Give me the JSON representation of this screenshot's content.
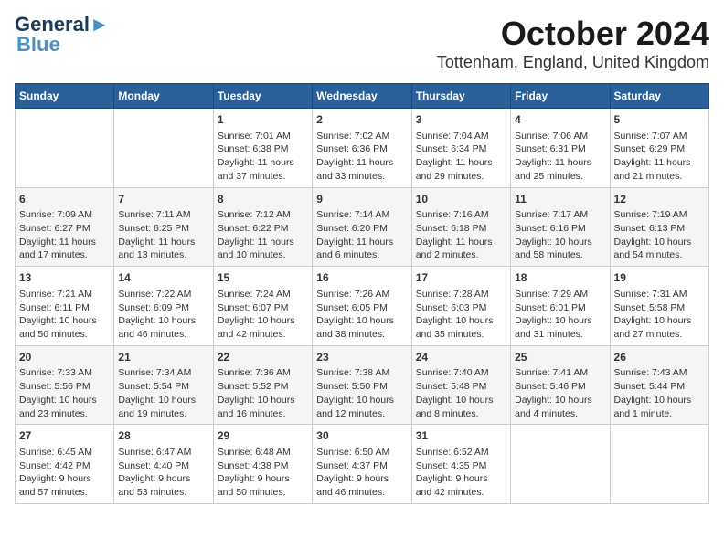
{
  "logo": {
    "text1": "General",
    "text2": "Blue"
  },
  "title": "October 2024",
  "subtitle": "Tottenham, England, United Kingdom",
  "headers": [
    "Sunday",
    "Monday",
    "Tuesday",
    "Wednesday",
    "Thursday",
    "Friday",
    "Saturday"
  ],
  "weeks": [
    [
      {
        "num": "",
        "content": ""
      },
      {
        "num": "",
        "content": ""
      },
      {
        "num": "1",
        "content": "Sunrise: 7:01 AM\nSunset: 6:38 PM\nDaylight: 11 hours\nand 37 minutes."
      },
      {
        "num": "2",
        "content": "Sunrise: 7:02 AM\nSunset: 6:36 PM\nDaylight: 11 hours\nand 33 minutes."
      },
      {
        "num": "3",
        "content": "Sunrise: 7:04 AM\nSunset: 6:34 PM\nDaylight: 11 hours\nand 29 minutes."
      },
      {
        "num": "4",
        "content": "Sunrise: 7:06 AM\nSunset: 6:31 PM\nDaylight: 11 hours\nand 25 minutes."
      },
      {
        "num": "5",
        "content": "Sunrise: 7:07 AM\nSunset: 6:29 PM\nDaylight: 11 hours\nand 21 minutes."
      }
    ],
    [
      {
        "num": "6",
        "content": "Sunrise: 7:09 AM\nSunset: 6:27 PM\nDaylight: 11 hours\nand 17 minutes."
      },
      {
        "num": "7",
        "content": "Sunrise: 7:11 AM\nSunset: 6:25 PM\nDaylight: 11 hours\nand 13 minutes."
      },
      {
        "num": "8",
        "content": "Sunrise: 7:12 AM\nSunset: 6:22 PM\nDaylight: 11 hours\nand 10 minutes."
      },
      {
        "num": "9",
        "content": "Sunrise: 7:14 AM\nSunset: 6:20 PM\nDaylight: 11 hours\nand 6 minutes."
      },
      {
        "num": "10",
        "content": "Sunrise: 7:16 AM\nSunset: 6:18 PM\nDaylight: 11 hours\nand 2 minutes."
      },
      {
        "num": "11",
        "content": "Sunrise: 7:17 AM\nSunset: 6:16 PM\nDaylight: 10 hours\nand 58 minutes."
      },
      {
        "num": "12",
        "content": "Sunrise: 7:19 AM\nSunset: 6:13 PM\nDaylight: 10 hours\nand 54 minutes."
      }
    ],
    [
      {
        "num": "13",
        "content": "Sunrise: 7:21 AM\nSunset: 6:11 PM\nDaylight: 10 hours\nand 50 minutes."
      },
      {
        "num": "14",
        "content": "Sunrise: 7:22 AM\nSunset: 6:09 PM\nDaylight: 10 hours\nand 46 minutes."
      },
      {
        "num": "15",
        "content": "Sunrise: 7:24 AM\nSunset: 6:07 PM\nDaylight: 10 hours\nand 42 minutes."
      },
      {
        "num": "16",
        "content": "Sunrise: 7:26 AM\nSunset: 6:05 PM\nDaylight: 10 hours\nand 38 minutes."
      },
      {
        "num": "17",
        "content": "Sunrise: 7:28 AM\nSunset: 6:03 PM\nDaylight: 10 hours\nand 35 minutes."
      },
      {
        "num": "18",
        "content": "Sunrise: 7:29 AM\nSunset: 6:01 PM\nDaylight: 10 hours\nand 31 minutes."
      },
      {
        "num": "19",
        "content": "Sunrise: 7:31 AM\nSunset: 5:58 PM\nDaylight: 10 hours\nand 27 minutes."
      }
    ],
    [
      {
        "num": "20",
        "content": "Sunrise: 7:33 AM\nSunset: 5:56 PM\nDaylight: 10 hours\nand 23 minutes."
      },
      {
        "num": "21",
        "content": "Sunrise: 7:34 AM\nSunset: 5:54 PM\nDaylight: 10 hours\nand 19 minutes."
      },
      {
        "num": "22",
        "content": "Sunrise: 7:36 AM\nSunset: 5:52 PM\nDaylight: 10 hours\nand 16 minutes."
      },
      {
        "num": "23",
        "content": "Sunrise: 7:38 AM\nSunset: 5:50 PM\nDaylight: 10 hours\nand 12 minutes."
      },
      {
        "num": "24",
        "content": "Sunrise: 7:40 AM\nSunset: 5:48 PM\nDaylight: 10 hours\nand 8 minutes."
      },
      {
        "num": "25",
        "content": "Sunrise: 7:41 AM\nSunset: 5:46 PM\nDaylight: 10 hours\nand 4 minutes."
      },
      {
        "num": "26",
        "content": "Sunrise: 7:43 AM\nSunset: 5:44 PM\nDaylight: 10 hours\nand 1 minute."
      }
    ],
    [
      {
        "num": "27",
        "content": "Sunrise: 6:45 AM\nSunset: 4:42 PM\nDaylight: 9 hours\nand 57 minutes."
      },
      {
        "num": "28",
        "content": "Sunrise: 6:47 AM\nSunset: 4:40 PM\nDaylight: 9 hours\nand 53 minutes."
      },
      {
        "num": "29",
        "content": "Sunrise: 6:48 AM\nSunset: 4:38 PM\nDaylight: 9 hours\nand 50 minutes."
      },
      {
        "num": "30",
        "content": "Sunrise: 6:50 AM\nSunset: 4:37 PM\nDaylight: 9 hours\nand 46 minutes."
      },
      {
        "num": "31",
        "content": "Sunrise: 6:52 AM\nSunset: 4:35 PM\nDaylight: 9 hours\nand 42 minutes."
      },
      {
        "num": "",
        "content": ""
      },
      {
        "num": "",
        "content": ""
      }
    ]
  ]
}
